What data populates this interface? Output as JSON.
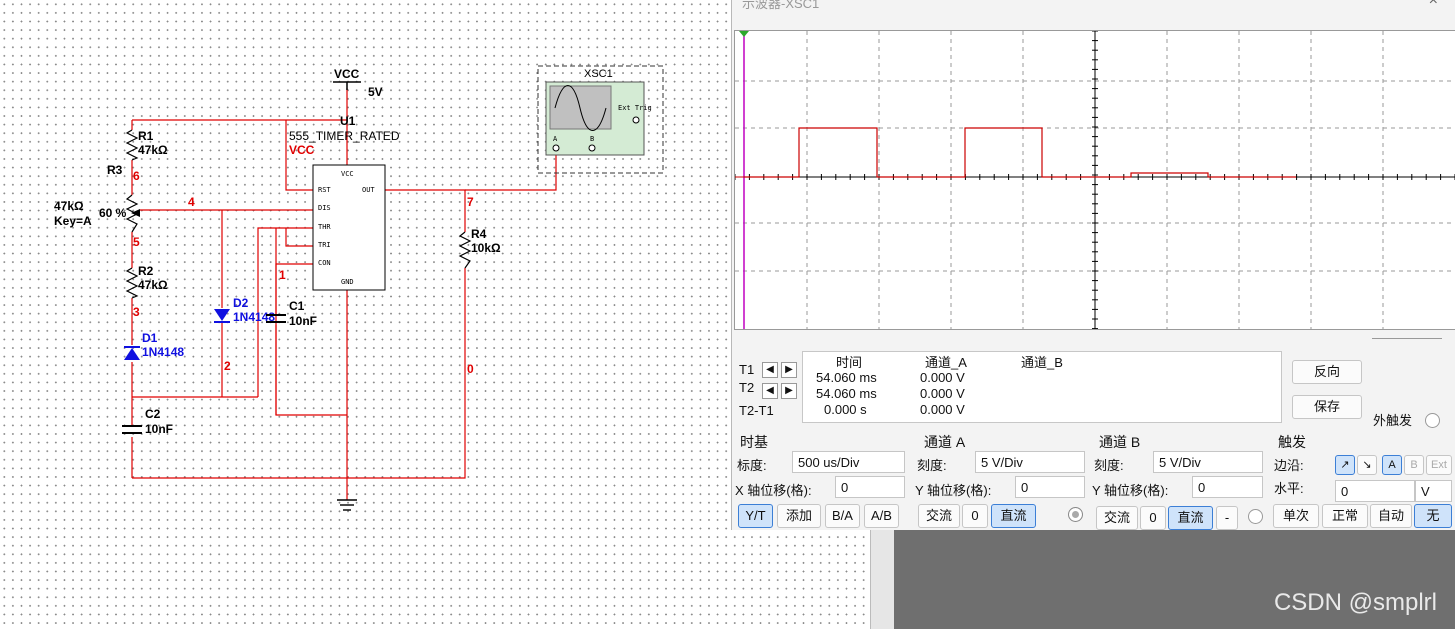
{
  "schematic": {
    "vcc_label": "VCC",
    "vcc_voltage": "5V",
    "u1_ref": "U1",
    "u1_part": "555_TIMER_RATED",
    "u1_vcc_net": "VCC",
    "chip_pins": {
      "vcc": "VCC",
      "rst": "RST",
      "dis": "DIS",
      "thr": "THR",
      "tri": "TRI",
      "con": "CON",
      "out": "OUT",
      "gnd": "GND"
    },
    "r1_ref": "R1",
    "r1_value": "47kΩ",
    "r3_ref": "R3",
    "r3_value": "47kΩ",
    "r3_key": "Key=A",
    "r3_percent": "60 %",
    "r2_ref": "R2",
    "r2_value": "47kΩ",
    "r4_ref": "R4",
    "r4_value": "10kΩ",
    "d1_ref": "D1",
    "d1_part": "1N4148",
    "d2_ref": "D2",
    "d2_part": "1N4148",
    "c1_ref": "C1",
    "c1_value": "10nF",
    "c2_ref": "C2",
    "c2_value": "10nF",
    "nets": {
      "n6": "6",
      "n4": "4",
      "n5": "5",
      "n3": "3",
      "n2": "2",
      "n1": "1",
      "n7": "7",
      "n0": "0"
    },
    "xsc_ref": "XSC1",
    "xsc_trig": "Ext Trig",
    "xsc_a": "A",
    "xsc_b": "B"
  },
  "oscilloscope": {
    "title": "示波器-XSC1",
    "close_icon": "×",
    "waveform_color": "#cc0000",
    "trigger_marker_color": "#c000c0",
    "readout": {
      "headers": [
        "时间",
        "通道_A",
        "通道_B"
      ],
      "rows": [
        {
          "label": "T1",
          "time": "54.060 ms",
          "a": "0.000 V",
          "b": ""
        },
        {
          "label": "T2",
          "time": "54.060 ms",
          "a": "0.000 V",
          "b": ""
        },
        {
          "label": "T2-T1",
          "time": "0.000 s",
          "a": "0.000 V",
          "b": ""
        }
      ]
    },
    "reverse_button": "反向",
    "save_button": "保存",
    "ext_trigger_label": "外触发",
    "timebase": {
      "header": "时基",
      "scale_label": "标度:",
      "scale_value": "500 us/Div",
      "xpos_label": "X 轴位移(格):",
      "xpos_value": "0",
      "modes": [
        "Y/T",
        "添加",
        "B/A",
        "A/B"
      ],
      "active_mode": "Y/T"
    },
    "channel_a": {
      "header": "通道 A",
      "scale_label": "刻度:",
      "scale_value": "5  V/Div",
      "ypos_label": "Y 轴位移(格):",
      "ypos_value": "0",
      "coupling": [
        "交流",
        "0",
        "直流"
      ],
      "active": "直流"
    },
    "channel_b": {
      "header": "通道 B",
      "scale_label": "刻度:",
      "scale_value": "5  V/Div",
      "ypos_label": "Y 轴位移(格):",
      "ypos_value": "0",
      "coupling": [
        "交流",
        "0",
        "直流",
        "-"
      ],
      "active": "直流"
    },
    "trigger": {
      "header": "触发",
      "edge_label": "边沿:",
      "edge_buttons": [
        "↗",
        "↘",
        "A",
        "B",
        "Ext"
      ],
      "active_edge": [
        "↗",
        "A"
      ],
      "level_label": "水平:",
      "level_value": "0",
      "level_unit": "V",
      "modes": [
        "单次",
        "正常",
        "自动",
        "无"
      ],
      "active_mode": "无"
    }
  },
  "watermark": "CSDN @smplrl"
}
